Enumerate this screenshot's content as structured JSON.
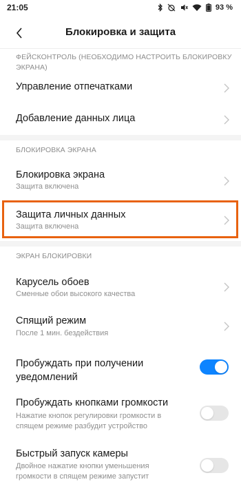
{
  "status_bar": {
    "time": "21:05",
    "battery": "93 %",
    "icons": [
      "bluetooth-icon",
      "alarm-off-icon",
      "mute-icon",
      "wifi-icon",
      "battery-icon"
    ]
  },
  "header": {
    "title": "Блокировка и защита",
    "back_icon": "chevron-left-icon"
  },
  "sections": {
    "face": {
      "label_line1": "ФЕЙСКОНТРОЛЬ (НЕОБХОДИМО НАСТРОИТЬ БЛОКИРОВКУ",
      "label_line2": "ЭКРАНА)",
      "items": [
        {
          "title": "Управление отпечатками"
        },
        {
          "title": "Добавление данных лица"
        }
      ]
    },
    "screen_lock": {
      "label": "БЛОКИРОВКА ЭКРАНА",
      "items": [
        {
          "title": "Блокировка экрана",
          "subtitle": "Защита включена"
        },
        {
          "title": "Защита личных данных",
          "subtitle": "Защита включена"
        }
      ]
    },
    "lock_screen": {
      "label": "ЭКРАН БЛОКИРОВКИ",
      "items": [
        {
          "title": "Карусель обоев",
          "subtitle": "Сменные обои высокого качества"
        },
        {
          "title": "Спящий режим",
          "subtitle": "После 1 мин. бездействия"
        },
        {
          "title_line1": "Пробуждать при получении",
          "title_line2": "уведомлений",
          "toggle": true
        },
        {
          "title": "Пробуждать кнопками громкости",
          "subtitle_line1": "Нажатие кнопок регулировки громкости в",
          "subtitle_line2": "спящем режиме разбудит устройство",
          "toggle": false
        },
        {
          "title": "Быстрый запуск камеры",
          "subtitle_line1": "Двойное нажатие кнопки уменьшения",
          "subtitle_line2": "громкости в спящем режиме запустит",
          "toggle": false
        }
      ]
    }
  },
  "colors": {
    "accent": "#0d84ff",
    "highlight": "#e8620f",
    "section_text": "#8c8c8c",
    "band": "#f4f4f4"
  }
}
